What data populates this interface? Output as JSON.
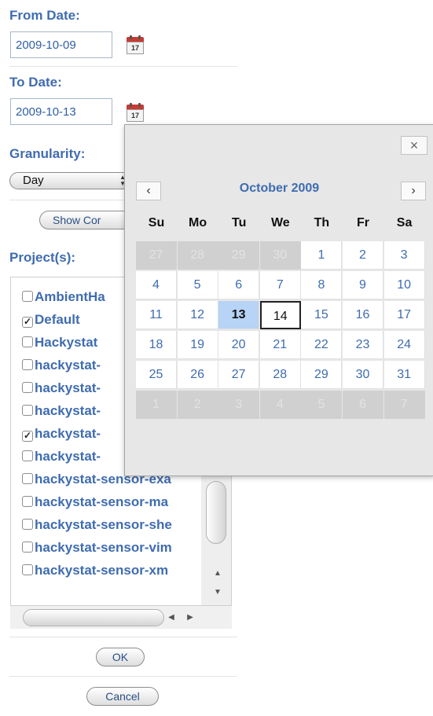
{
  "from_date": {
    "label": "From Date:",
    "value": "2009-10-09"
  },
  "to_date": {
    "label": "To Date:",
    "value": "2009-10-13"
  },
  "calendar_icon_text": "17",
  "granularity": {
    "label": "Granularity:",
    "selected": "Day"
  },
  "show_button_label": "Show Cor",
  "projects": {
    "label": "Project(s):",
    "items": [
      {
        "name": "AmbientHa",
        "checked": false
      },
      {
        "name": "Default",
        "checked": true
      },
      {
        "name": "Hackystat",
        "checked": false
      },
      {
        "name": "hackystat-",
        "checked": false
      },
      {
        "name": "hackystat-",
        "checked": false
      },
      {
        "name": "hackystat-",
        "checked": false
      },
      {
        "name": "hackystat-",
        "checked": true
      },
      {
        "name": "hackystat-",
        "checked": false
      },
      {
        "name": "hackystat-sensor-exa",
        "checked": false
      },
      {
        "name": "hackystat-sensor-ma",
        "checked": false
      },
      {
        "name": "hackystat-sensor-she",
        "checked": false
      },
      {
        "name": "hackystat-sensor-vim",
        "checked": false
      },
      {
        "name": "hackystat-sensor-xm",
        "checked": false
      }
    ]
  },
  "ok_label": "OK",
  "cancel_label": "Cancel",
  "calendar": {
    "close_glyph": "×",
    "prev_glyph": "‹",
    "next_glyph": "›",
    "month_title": "October 2009",
    "weekdays": [
      "Su",
      "Mo",
      "Tu",
      "We",
      "Th",
      "Fr",
      "Sa"
    ],
    "weeks": [
      [
        {
          "d": "27",
          "o": true
        },
        {
          "d": "28",
          "o": true
        },
        {
          "d": "29",
          "o": true
        },
        {
          "d": "30",
          "o": true
        },
        {
          "d": "1"
        },
        {
          "d": "2"
        },
        {
          "d": "3"
        }
      ],
      [
        {
          "d": "4"
        },
        {
          "d": "5"
        },
        {
          "d": "6"
        },
        {
          "d": "7"
        },
        {
          "d": "8"
        },
        {
          "d": "9"
        },
        {
          "d": "10"
        }
      ],
      [
        {
          "d": "11"
        },
        {
          "d": "12"
        },
        {
          "d": "13",
          "today": true
        },
        {
          "d": "14",
          "sel": true
        },
        {
          "d": "15"
        },
        {
          "d": "16"
        },
        {
          "d": "17"
        }
      ],
      [
        {
          "d": "18"
        },
        {
          "d": "19"
        },
        {
          "d": "20"
        },
        {
          "d": "21"
        },
        {
          "d": "22"
        },
        {
          "d": "23"
        },
        {
          "d": "24"
        }
      ],
      [
        {
          "d": "25"
        },
        {
          "d": "26"
        },
        {
          "d": "27"
        },
        {
          "d": "28"
        },
        {
          "d": "29"
        },
        {
          "d": "30"
        },
        {
          "d": "31"
        }
      ],
      [
        {
          "d": "1",
          "o": true
        },
        {
          "d": "2",
          "o": true
        },
        {
          "d": "3",
          "o": true
        },
        {
          "d": "4",
          "o": true
        },
        {
          "d": "5",
          "o": true
        },
        {
          "d": "6",
          "o": true
        },
        {
          "d": "7",
          "o": true
        }
      ]
    ]
  }
}
